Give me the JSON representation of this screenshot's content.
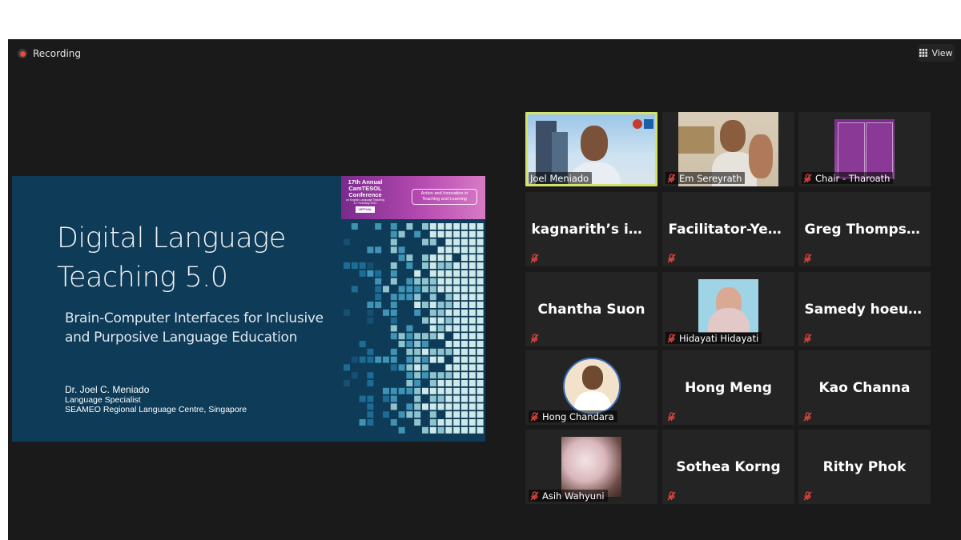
{
  "meeting": {
    "recording_label": "Recording",
    "view_label": "View"
  },
  "slide": {
    "banner_title": "17th Annual CamTESOL Conference",
    "banner_sub": "on English Language Teaching",
    "banner_dates": "4-7 February 2021",
    "banner_mode": "VIRTUAL",
    "banner_theme": "Action and Innovation in Teaching and Learning",
    "title": "Digital Language\nTeaching 5.0",
    "subtitle": "Brain-Computer Interfaces for Inclusive\nand Purposive Language Education",
    "author_name": "Dr. Joel C. Meniado",
    "author_role": "Language Specialist",
    "author_org": "SEAMEO Regional Language Centre, Singapore"
  },
  "participants": [
    {
      "name": "Joel Meniado",
      "type": "video",
      "muted": false,
      "active": true
    },
    {
      "name": "Em Sereyrath",
      "type": "video",
      "muted": true
    },
    {
      "name": "Chair - Tharoath",
      "type": "video",
      "muted": true
    },
    {
      "name": "kagnarith’s iPh…",
      "type": "name",
      "muted": true
    },
    {
      "name": "Facilitator-Yeau…",
      "type": "name",
      "muted": true
    },
    {
      "name": "Greg Thompson",
      "type": "name",
      "muted": true
    },
    {
      "name": "Chantha Suon",
      "type": "name",
      "muted": true
    },
    {
      "name": "Hidayati Hidayati",
      "type": "photo",
      "muted": true
    },
    {
      "name": "Samedy hoeurng",
      "type": "name",
      "muted": true
    },
    {
      "name": "Hong Chandara",
      "type": "avatar",
      "muted": true
    },
    {
      "name": "Hong Meng",
      "type": "name",
      "muted": true
    },
    {
      "name": "Kao Channa",
      "type": "name",
      "muted": true
    },
    {
      "name": "Asih Wahyuni",
      "type": "photo",
      "muted": true
    },
    {
      "name": "Sothea Korng",
      "type": "name",
      "muted": true
    },
    {
      "name": "Rithy Phok",
      "type": "name",
      "muted": true
    }
  ],
  "colors": {
    "stage_bg": "#1a1a1a",
    "tile_bg": "#242424",
    "active_speaker": "#d2e26c",
    "mute_icon": "#e0463c",
    "slide_bg": "#0e3b57"
  }
}
